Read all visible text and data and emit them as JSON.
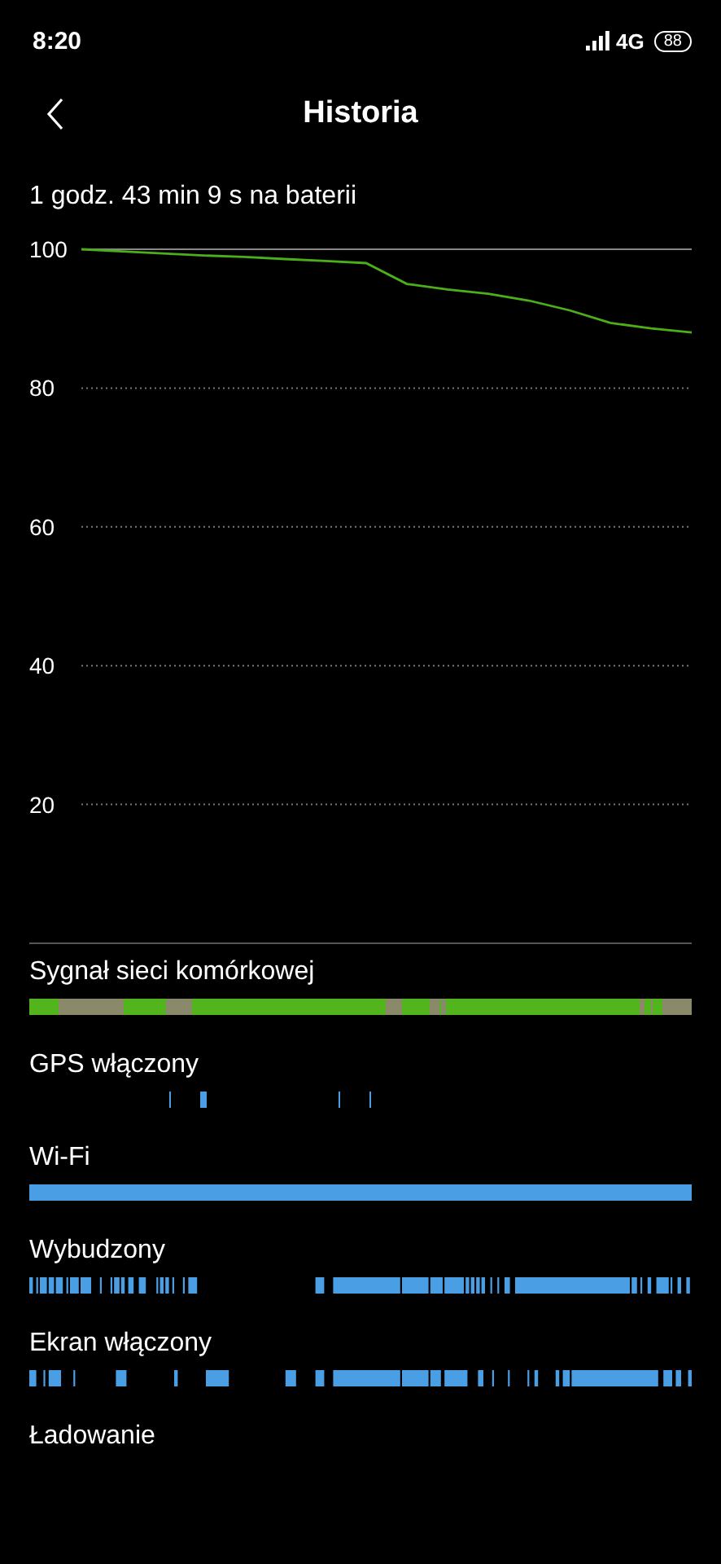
{
  "status_bar": {
    "time": "8:20",
    "network": "4G",
    "battery": "88"
  },
  "header": {
    "title": "Historia"
  },
  "summary": "1 godz. 43 min 9 s na baterii",
  "battery_chart": {
    "chart_data": {
      "type": "line",
      "grid": true,
      "ylim": [
        0,
        100
      ],
      "yticks": [
        20,
        40,
        60,
        80,
        100
      ],
      "series": [
        {
          "color": "#4caf1a",
          "values": [
            100,
            99.7,
            99.4,
            99.1,
            98.9,
            98.6,
            98.3,
            98,
            95,
            94.2,
            93.6,
            92.6,
            91.2,
            89.4,
            88.6,
            88
          ]
        }
      ]
    }
  },
  "timelines": [
    {
      "label": "Sygnał sieci komórkowej",
      "kind": "signal"
    },
    {
      "label": "GPS włączony",
      "kind": "gps"
    },
    {
      "label": "Wi-Fi",
      "kind": "wifi"
    },
    {
      "label": "Wybudzony",
      "kind": "awake"
    },
    {
      "label": "Ekran włączony",
      "kind": "screen"
    },
    {
      "label": "Ładowanie",
      "kind": "none"
    }
  ]
}
